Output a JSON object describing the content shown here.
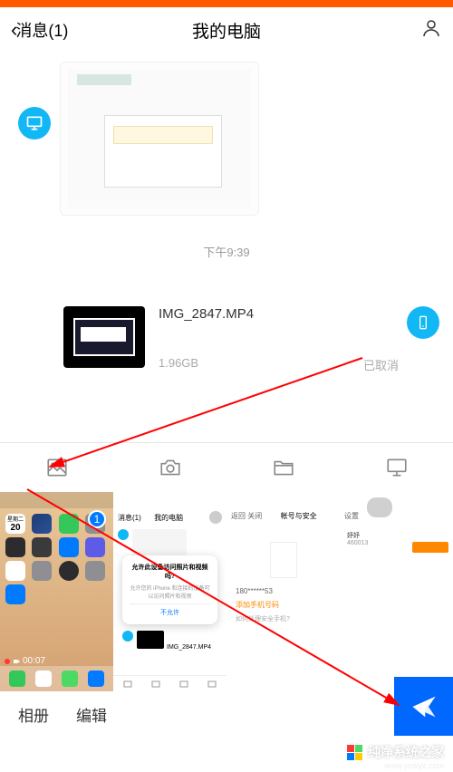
{
  "header": {
    "back_label": "消息(1)",
    "title": "我的电脑"
  },
  "chat": {
    "timestamp": "下午9:39",
    "file": {
      "name": "IMG_2847.MP4",
      "size": "1.96GB",
      "status": "已取消"
    }
  },
  "gallery": {
    "badge_count": "1",
    "cal_weekday": "星期二",
    "cal_day": "20",
    "rec_time": "00:07",
    "dlg_title": "允许此设备访问照片和视频吗?",
    "dlg_sub": "允许您的 iPhone 和连接的设备可以访问照片和视频",
    "dlg_cancel": "不允许",
    "mini_header_back": "消息(1)",
    "mini_header_title": "我的电脑",
    "mini_file": "IMG_2847.MP4",
    "g2_back": "返回 关闭",
    "g2_title": "帐号与安全",
    "g2_line": "如何处理安全手机?",
    "g2_add": "添加手机号码",
    "g3_back": "设置"
  },
  "actions": {
    "album": "相册",
    "edit": "编辑"
  },
  "watermark": {
    "text": "纯净系统之家",
    "url": "www.ycwyz.com"
  }
}
